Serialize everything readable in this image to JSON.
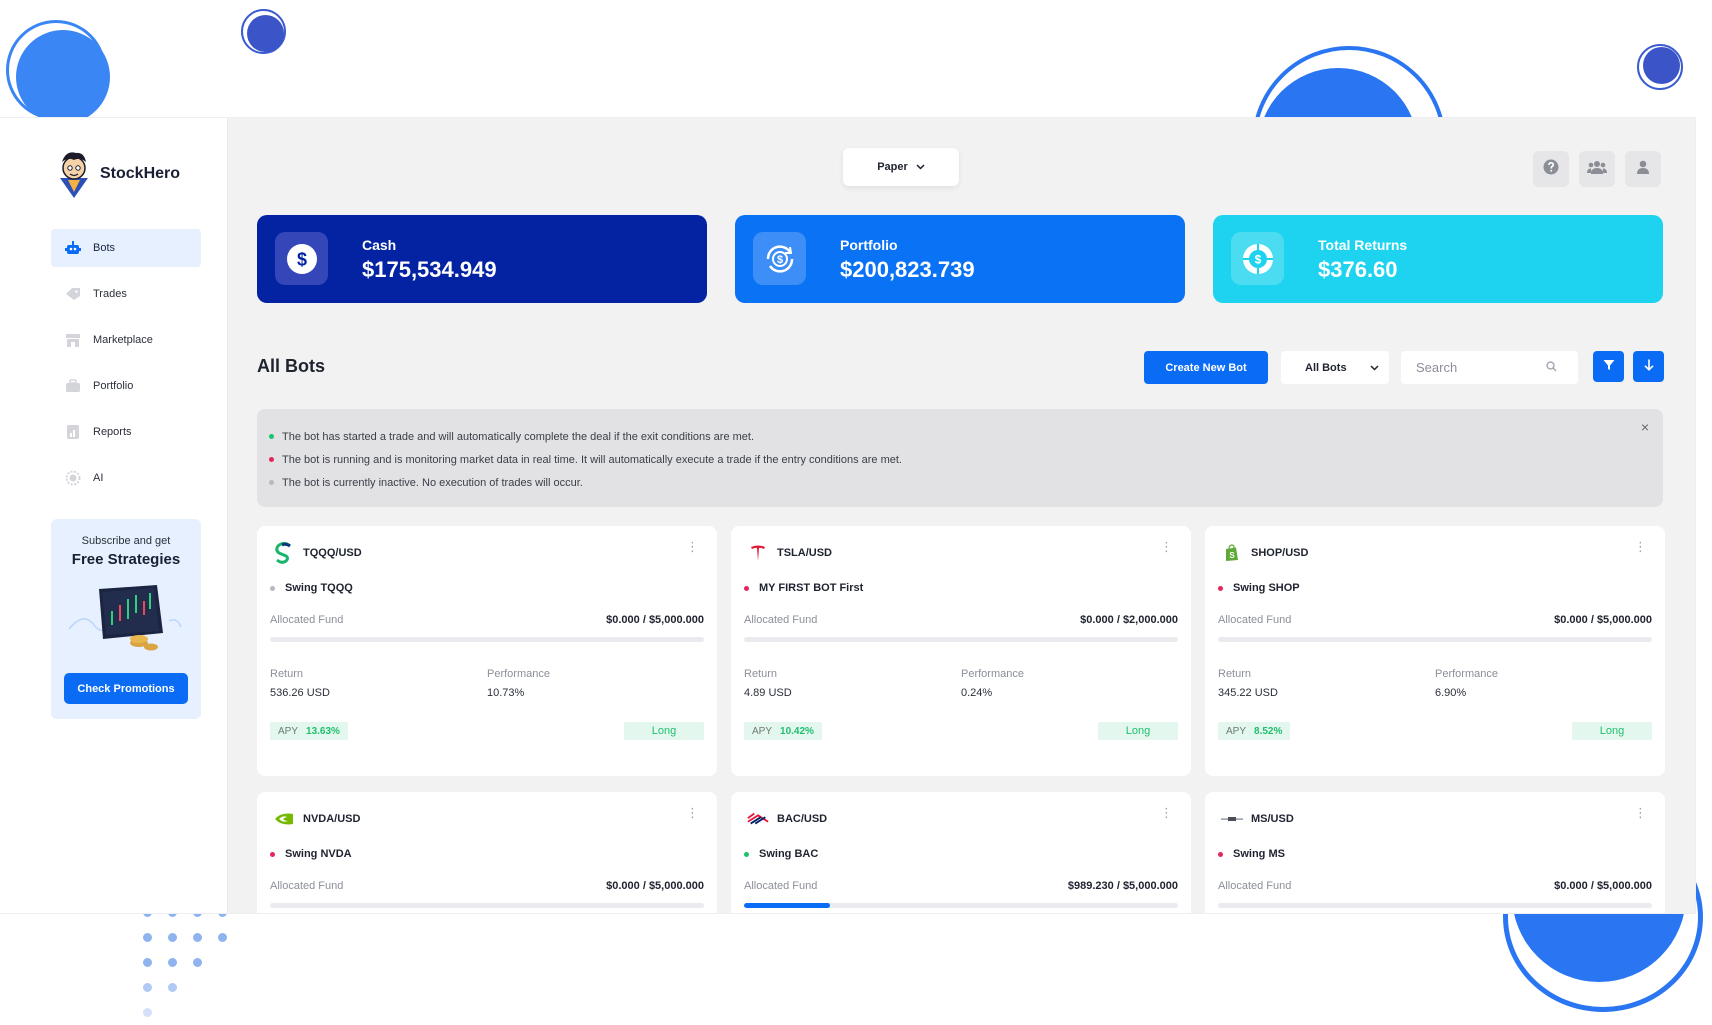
{
  "brand": {
    "name": "StockHero"
  },
  "sidebar": {
    "items": [
      {
        "label": "Bots",
        "icon": "robot-icon",
        "active": true
      },
      {
        "label": "Trades",
        "icon": "tag-icon"
      },
      {
        "label": "Marketplace",
        "icon": "store-icon"
      },
      {
        "label": "Portfolio",
        "icon": "briefcase-icon"
      },
      {
        "label": "Reports",
        "icon": "report-icon"
      },
      {
        "label": "AI",
        "icon": "chip-icon"
      }
    ],
    "promo": {
      "subtitle": "Subscribe and get",
      "title": "Free Strategies",
      "button": "Check Promotions"
    }
  },
  "header": {
    "mode": "Paper"
  },
  "stats": [
    {
      "label": "Cash",
      "value": "$175,534.949",
      "color": "#0323a3"
    },
    {
      "label": "Portfolio",
      "value": "$200,823.739",
      "color": "#0a72f5"
    },
    {
      "label": "Total Returns",
      "value": "$376.60",
      "color": "#1ed3ef"
    }
  ],
  "bots": {
    "title": "All Bots",
    "create_label": "Create New Bot",
    "filter_value": "All Bots",
    "search_placeholder": "Search"
  },
  "legend": [
    {
      "color": "#19c46f",
      "text": "The bot has started a trade and will automatically complete the deal if the exit conditions are met."
    },
    {
      "color": "#e5265c",
      "text": "The bot is running and is monitoring market data in real time. It will automatically execute a trade if the entry conditions are met."
    },
    {
      "color": "#b7b9bf",
      "text": "The bot is currently inactive. No execution of trades will occur."
    }
  ],
  "labels": {
    "allocated": "Allocated Fund",
    "return": "Return",
    "performance": "Performance",
    "apy": "APY"
  },
  "cards": [
    {
      "symbol": "TQQQ/USD",
      "name": "Swing TQQQ",
      "status_color": "#b7b9bf",
      "fund": "$0.000 / $5,000.000",
      "fund_progress": 0,
      "return": "536.26 USD",
      "performance": "10.73%",
      "apy": "13.63%",
      "side": "Long"
    },
    {
      "symbol": "TSLA/USD",
      "name": "MY FIRST BOT First",
      "status_color": "#e5265c",
      "fund": "$0.000 / $2,000.000",
      "fund_progress": 0,
      "return": "4.89 USD",
      "performance": "0.24%",
      "apy": "10.42%",
      "side": "Long"
    },
    {
      "symbol": "SHOP/USD",
      "name": "Swing SHOP",
      "status_color": "#e5265c",
      "fund": "$0.000 / $5,000.000",
      "fund_progress": 0,
      "return": "345.22 USD",
      "performance": "6.90%",
      "apy": "8.52%",
      "side": "Long"
    },
    {
      "symbol": "NVDA/USD",
      "name": "Swing NVDA",
      "status_color": "#e5265c",
      "fund": "$0.000 / $5,000.000",
      "fund_progress": 0
    },
    {
      "symbol": "BAC/USD",
      "name": "Swing BAC",
      "status_color": "#19c46f",
      "fund": "$989.230 / $5,000.000",
      "fund_progress": 0.198
    },
    {
      "symbol": "MS/USD",
      "name": "Swing MS",
      "status_color": "#e5265c",
      "fund": "$0.000 / $5,000.000",
      "fund_progress": 0
    }
  ]
}
